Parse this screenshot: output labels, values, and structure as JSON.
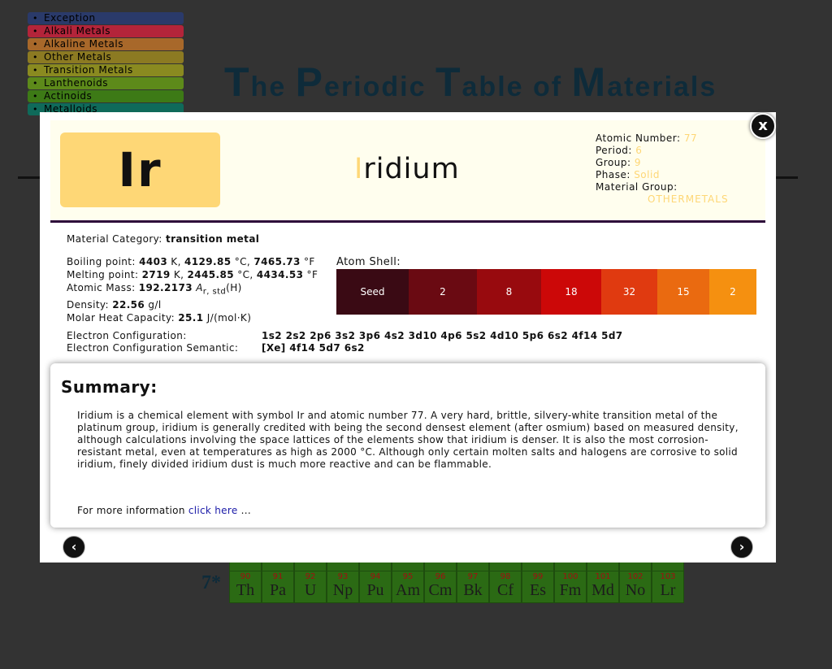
{
  "legend": [
    {
      "label": "Exception",
      "color": "#2a3a6a"
    },
    {
      "label": "Alkali Metals",
      "color": "#b3243a"
    },
    {
      "label": "Alkaline Metals",
      "color": "#a8682a"
    },
    {
      "label": "Other Metals",
      "color": "#8c7a22"
    },
    {
      "label": "Transition Metals",
      "color": "#8a8a20"
    },
    {
      "label": "Lanthenoids",
      "color": "#5d8a1a"
    },
    {
      "label": "Actinoids",
      "color": "#3d7a16"
    },
    {
      "label": "Metalloids",
      "color": "#0f6a5a"
    }
  ],
  "page_title": {
    "p1_cap": "T",
    "p1": "he ",
    "p2_cap": "P",
    "p2": "eriodic ",
    "p3_cap": "T",
    "p3": "able of ",
    "p4_cap": "M",
    "p4": "aterials"
  },
  "background_row": {
    "label": "7*",
    "cells": [
      {
        "n": "90",
        "s": "Th"
      },
      {
        "n": "91",
        "s": "Pa"
      },
      {
        "n": "92",
        "s": "U"
      },
      {
        "n": "93",
        "s": "Np"
      },
      {
        "n": "94",
        "s": "Pu"
      },
      {
        "n": "95",
        "s": "Am"
      },
      {
        "n": "96",
        "s": "Cm"
      },
      {
        "n": "97",
        "s": "Bk"
      },
      {
        "n": "98",
        "s": "Cf"
      },
      {
        "n": "99",
        "s": "Es"
      },
      {
        "n": "100",
        "s": "Fm"
      },
      {
        "n": "101",
        "s": "Md"
      },
      {
        "n": "102",
        "s": "No"
      },
      {
        "n": "103",
        "s": "Lr"
      }
    ]
  },
  "modal": {
    "close_label": "x",
    "symbol": "Ir",
    "name_first": "I",
    "name_rest": "ridium",
    "info": {
      "atomic_number_label": "Atomic Number: ",
      "atomic_number": "77",
      "period_label": "Period: ",
      "period": "6",
      "group_label": "Group: ",
      "group": "9",
      "phase_label": "Phase: ",
      "phase": "Solid",
      "material_group_label": "Material Group:",
      "material_group": "OTHERMETALS"
    },
    "category_label": "Material Category: ",
    "category": "transition metal",
    "boiling_label": "Boiling point: ",
    "boiling_k": "4403",
    "boiling_c": "4129.85",
    "boiling_f": "7465.73",
    "melting_label": "Melting point: ",
    "melting_k": "2719",
    "melting_c": "2445.85",
    "melting_f": "4434.53",
    "mass_label": "Atomic Mass: ",
    "mass": "192.2173",
    "density_label": "Density: ",
    "density": "22.56",
    "density_unit": "g/l",
    "heat_label": "Molar Heat Capacity: ",
    "heat": "25.1",
    "heat_unit": "J/(mol·K)",
    "unit_k": "K",
    "unit_c": "°C",
    "unit_f": "°F",
    "mass_a": "A",
    "mass_sub": "r, std",
    "mass_h": "(H)",
    "shell_label": "Atom Shell:",
    "shells": [
      {
        "label": "Seed",
        "color": "#3a0a14"
      },
      {
        "label": "2",
        "color": "#6a0a12"
      },
      {
        "label": "8",
        "color": "#980a0e"
      },
      {
        "label": "18",
        "color": "#cc0808"
      },
      {
        "label": "32",
        "color": "#e03a10"
      },
      {
        "label": "15",
        "color": "#ea6a10"
      },
      {
        "label": "2",
        "color": "#f59010"
      }
    ],
    "econf_label": "Electron Configuration:",
    "econf": "1s2 2s2 2p6 3s2 3p6 4s2 3d10 4p6 5s2 4d10 5p6 6s2 4f14 5d7",
    "econf_sem_label": "Electron Configuration Semantic:",
    "econf_sem": "[Xe] 4f14 5d7 6s2",
    "summary_title": "Summary:",
    "summary_text": "Iridium is a chemical element with symbol Ir and atomic number 77. A very hard, brittle, silvery-white transition metal of the platinum group, iridium is generally credited with being the second densest element (after osmium) based on measured density, although calculations involving the space lattices of the elements show that iridium is denser. It is also the most corrosion-resistant metal, even at temperatures as high as 2000 °C. Although only certain molten salts and halogens are corrosive to solid iridium, finely divided iridium dust is much more reactive and can be flammable.",
    "more_prefix": "For more information ",
    "more_link": "click here",
    "more_suffix": " ...",
    "prev_label": "‹",
    "next_label": "›"
  }
}
